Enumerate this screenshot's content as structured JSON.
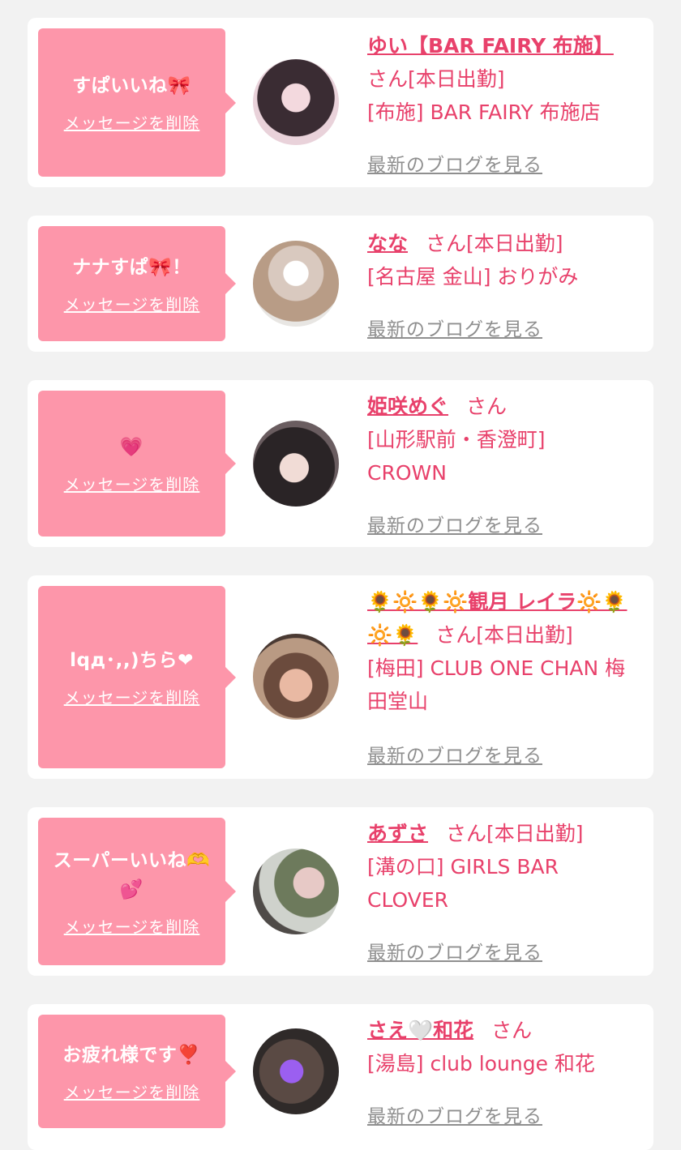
{
  "delete_label": "メッセージを削除",
  "blog_label": "最新のブログを見る",
  "colors": {
    "bubble": "#fd96aa",
    "accent": "#e8416b",
    "link_gray": "#8f8f8f",
    "background": "#f2f2f2"
  },
  "cards": [
    {
      "message": "すぱいいね🎀",
      "name": "ゆい【BAR FAIRY 布施】",
      "suffix": "さん",
      "status": "[本日出勤]",
      "store": "[布施] BAR FAIRY 布施店"
    },
    {
      "message": "ナナすぱ🎀！",
      "name": "なな",
      "suffix": "さん",
      "status": "[本日出勤]",
      "store": "[名古屋 金山] おりがみ"
    },
    {
      "message": "💗",
      "name": "姫咲めぐ",
      "suffix": "さん",
      "status": "",
      "store": "[山形駅前・香澄町] CROWN"
    },
    {
      "message": "lqд･,,)ちら❤",
      "name": "🌻🔆🌻🔆観月 レイラ🔆🌻🔆🌻",
      "suffix": "さん",
      "status": "[本日出勤]",
      "store": "[梅田] CLUB ONE CHAN 梅田堂山"
    },
    {
      "message": "スーパーいいね🫶💕",
      "name": "あずさ",
      "suffix": "さん",
      "status": "[本日出勤]",
      "store": "[溝の口] GIRLS BAR CLOVER"
    },
    {
      "message": "お疲れ様です❣️",
      "name": "さえ🤍和花",
      "suffix": "さん",
      "status": "",
      "store": "[湯島] club lounge 和花"
    }
  ]
}
